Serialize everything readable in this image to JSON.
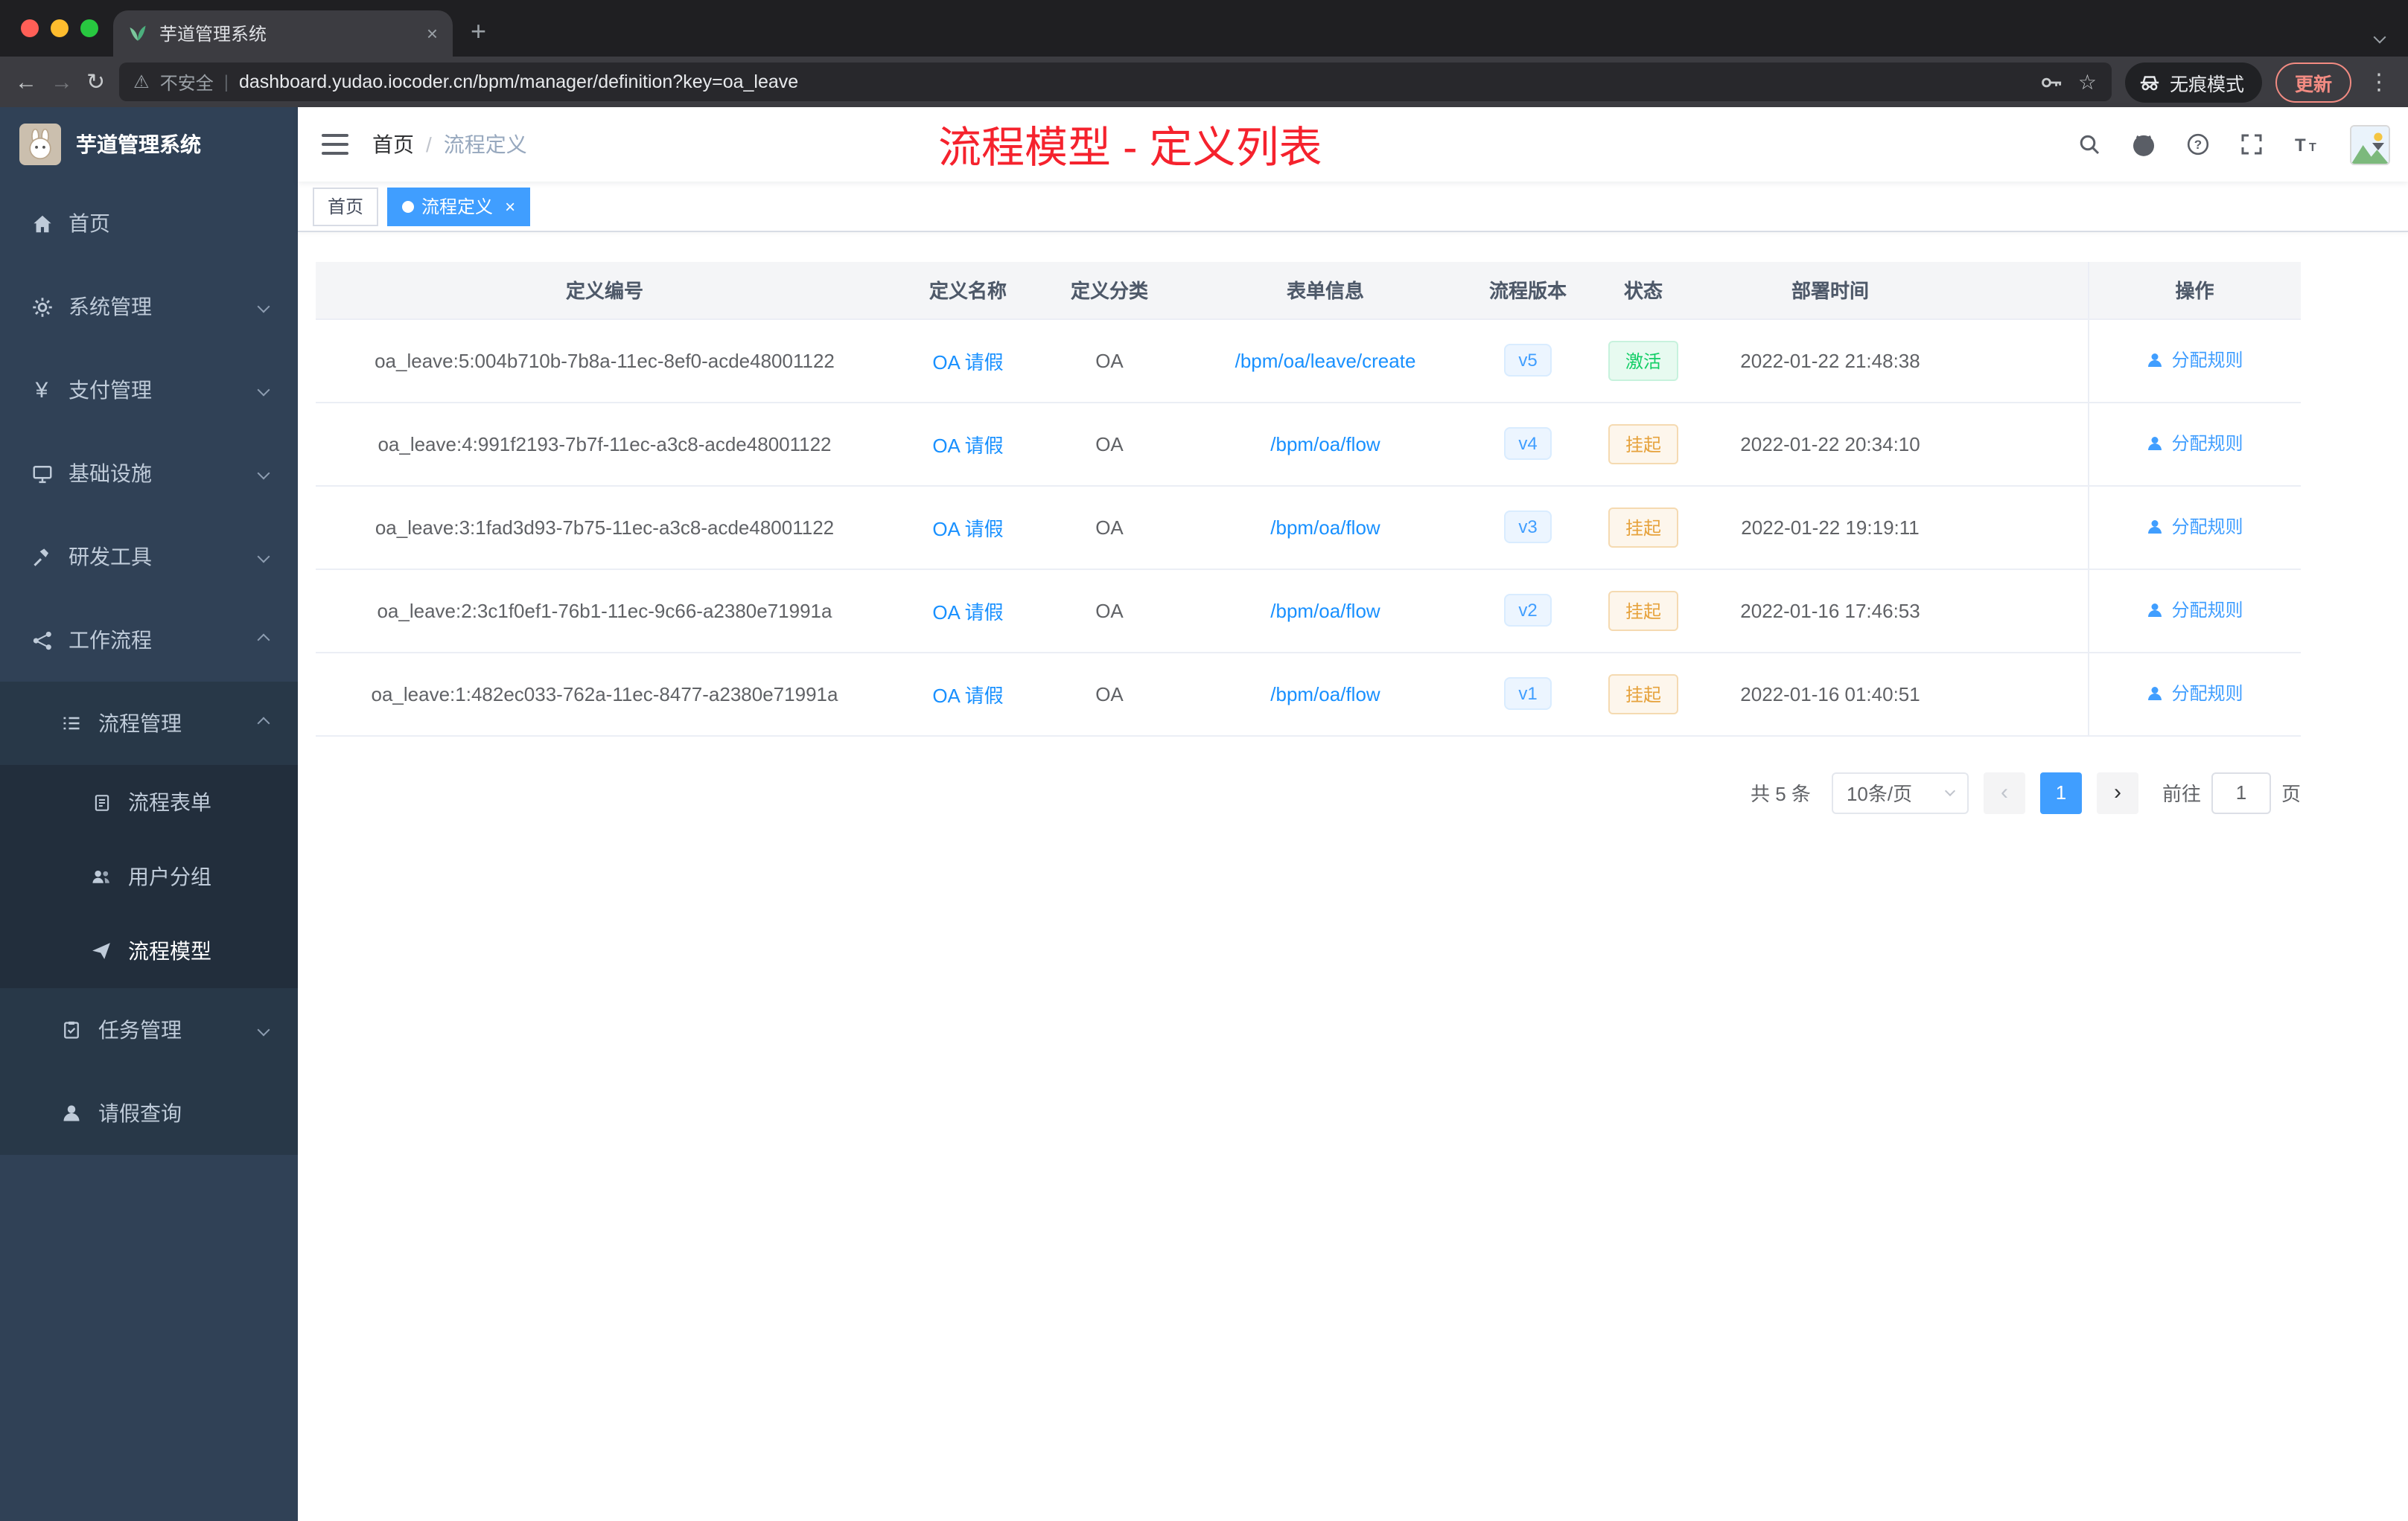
{
  "colors": {
    "accent": "#409eff",
    "link": "#1890ff",
    "annotation_red": "#f5222d",
    "success_green": "#13ce66",
    "warning_orange": "#e6a23c",
    "sidebar_bg": "#304156"
  },
  "browser": {
    "tab_title": "芋道管理系统",
    "security_label": "不安全",
    "url": "dashboard.yudao.iocoder.cn/bpm/manager/definition?key=oa_leave",
    "incognito_label": "无痕模式",
    "update_label": "更新"
  },
  "sidebar": {
    "brand": "芋道管理系统",
    "items": [
      {
        "label": "首页",
        "icon": "home-icon"
      },
      {
        "label": "系统管理",
        "icon": "gear-icon"
      },
      {
        "label": "支付管理",
        "icon": "yen-icon"
      },
      {
        "label": "基础设施",
        "icon": "monitor-icon"
      },
      {
        "label": "研发工具",
        "icon": "tools-icon"
      },
      {
        "label": "工作流程",
        "icon": "workflow-icon"
      }
    ],
    "process_group": {
      "label": "流程管理",
      "icon": "list-icon"
    },
    "process_children": [
      {
        "label": "流程表单",
        "icon": "form-icon"
      },
      {
        "label": "用户分组",
        "icon": "users-icon"
      },
      {
        "label": "流程模型",
        "icon": "plane-icon"
      }
    ],
    "task_group": {
      "label": "任务管理",
      "icon": "task-icon"
    },
    "leave_item": {
      "label": "请假查询",
      "icon": "person-icon"
    }
  },
  "navbar": {
    "breadcrumb_home": "首页",
    "breadcrumb_sep": "/",
    "breadcrumb_current": "流程定义",
    "annotation": "流程模型 - 定义列表"
  },
  "tags": {
    "home": "首页",
    "active": "流程定义"
  },
  "table": {
    "columns": [
      "定义编号",
      "定义名称",
      "定义分类",
      "表单信息",
      "流程版本",
      "状态",
      "部署时间",
      "操作"
    ],
    "rows": [
      {
        "id": "oa_leave:5:004b710b-7b8a-11ec-8ef0-acde48001122",
        "name": "OA 请假",
        "category": "OA",
        "form": "/bpm/oa/leave/create",
        "version": "v5",
        "status": "激活",
        "status_type": "success",
        "time": "2022-01-22 21:48:38",
        "action": "分配规则"
      },
      {
        "id": "oa_leave:4:991f2193-7b7f-11ec-a3c8-acde48001122",
        "name": "OA 请假",
        "category": "OA",
        "form": "/bpm/oa/flow",
        "version": "v4",
        "status": "挂起",
        "status_type": "warning",
        "time": "2022-01-22 20:34:10",
        "action": "分配规则"
      },
      {
        "id": "oa_leave:3:1fad3d93-7b75-11ec-a3c8-acde48001122",
        "name": "OA 请假",
        "category": "OA",
        "form": "/bpm/oa/flow",
        "version": "v3",
        "status": "挂起",
        "status_type": "warning",
        "time": "2022-01-22 19:19:11",
        "action": "分配规则"
      },
      {
        "id": "oa_leave:2:3c1f0ef1-76b1-11ec-9c66-a2380e71991a",
        "name": "OA 请假",
        "category": "OA",
        "form": "/bpm/oa/flow",
        "version": "v2",
        "status": "挂起",
        "status_type": "warning",
        "time": "2022-01-16 17:46:53",
        "action": "分配规则"
      },
      {
        "id": "oa_leave:1:482ec033-762a-11ec-8477-a2380e71991a",
        "name": "OA 请假",
        "category": "OA",
        "form": "/bpm/oa/flow",
        "version": "v1",
        "status": "挂起",
        "status_type": "warning",
        "time": "2022-01-16 01:40:51",
        "action": "分配规则"
      }
    ]
  },
  "pagination": {
    "total": "共 5 条",
    "page_size": "10条/页",
    "prev": "‹",
    "page": "1",
    "next": "›",
    "goto_label": "前往",
    "goto_value": "1",
    "unit_label": "页"
  }
}
